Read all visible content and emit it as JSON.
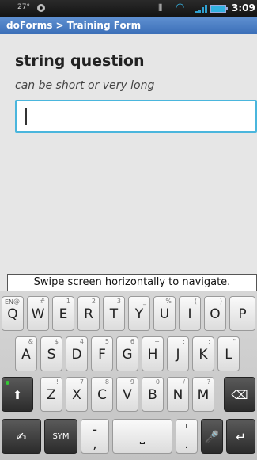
{
  "status_bar": {
    "temperature": "27°",
    "time": "3:09",
    "icons": [
      "gps-icon",
      "vibrate-icon",
      "wifi-icon",
      "signal-icon",
      "battery-icon"
    ],
    "colors": {
      "wifi": "#36b6e6",
      "battery": "#31b0e0"
    }
  },
  "title_bar": {
    "title": "doForms > Training Form",
    "color": "#4a7ec4"
  },
  "form": {
    "question": "string question",
    "hint": "can be short or very long",
    "answer_value": "",
    "field_border_color": "#4ab6dd"
  },
  "navigation_hint": "Swipe screen horizontally to navigate.",
  "keyboard": {
    "row1": [
      {
        "main": "Q",
        "alt": "@"
      },
      {
        "main": "W",
        "alt": "#"
      },
      {
        "main": "E",
        "alt": "1"
      },
      {
        "main": "R",
        "alt": "2"
      },
      {
        "main": "T",
        "alt": "3"
      },
      {
        "main": "Y",
        "alt": "_"
      },
      {
        "main": "U",
        "alt": "%"
      },
      {
        "main": "I",
        "alt": "("
      },
      {
        "main": "O",
        "alt": ")"
      },
      {
        "main": "P",
        "alt": ""
      }
    ],
    "row2": [
      {
        "main": "A",
        "alt": "&"
      },
      {
        "main": "S",
        "alt": "$"
      },
      {
        "main": "D",
        "alt": "4"
      },
      {
        "main": "F",
        "alt": "5"
      },
      {
        "main": "G",
        "alt": "6"
      },
      {
        "main": "H",
        "alt": "+"
      },
      {
        "main": "J",
        "alt": ":"
      },
      {
        "main": "K",
        "alt": ";"
      },
      {
        "main": "L",
        "alt": "\""
      }
    ],
    "row3": [
      {
        "main": "Z",
        "alt": "!"
      },
      {
        "main": "X",
        "alt": "7"
      },
      {
        "main": "C",
        "alt": "8"
      },
      {
        "main": "V",
        "alt": "9"
      },
      {
        "main": "B",
        "alt": "0"
      },
      {
        "main": "N",
        "alt": "/"
      },
      {
        "main": "M",
        "alt": "?"
      }
    ],
    "language_label": "EN",
    "shift_glyph": "⬆",
    "backspace_glyph": "⌫",
    "swype_glyph": "✍",
    "sym_label": "SYM",
    "dash_comma_glyph": "-\n,",
    "space_glyph": "⎵",
    "quote_period_glyph": "'\n.",
    "mic_glyph": "🎤",
    "enter_glyph": "↵"
  }
}
